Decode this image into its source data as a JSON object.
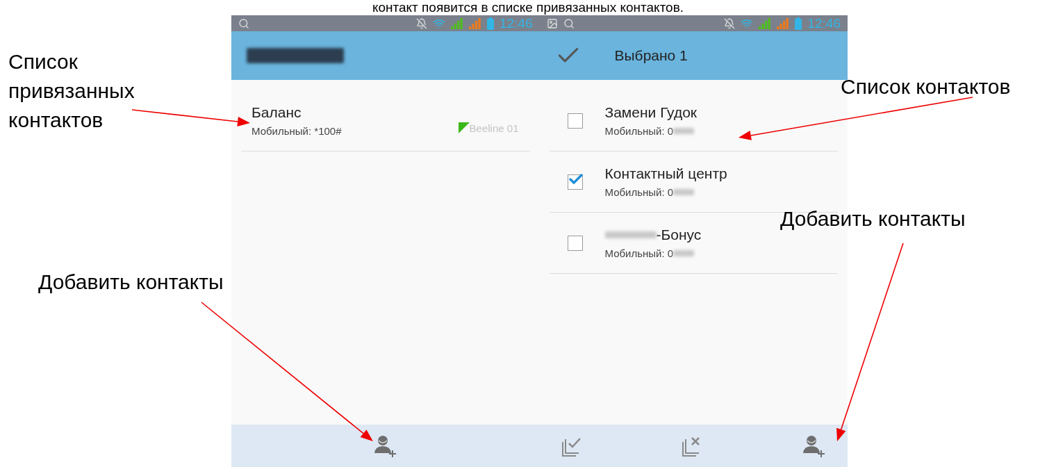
{
  "heading": "контакт появится в списке привязанных контактов.",
  "screens": [
    {
      "kind": "linked",
      "status_bar": {
        "time": "12:46"
      },
      "contacts": [
        {
          "name": "Баланс",
          "name_blurred": false,
          "phone": "Мобильный: *100#",
          "phone_blurred": false,
          "sim": "Beeline 01"
        }
      ],
      "bottom_actions": [
        {
          "kind": "add-contact"
        }
      ]
    },
    {
      "kind": "select",
      "status_bar": {
        "time": "12:46"
      },
      "app_bar": {
        "title": "Выбрано 1"
      },
      "contacts": [
        {
          "name": "Замени Гудок",
          "name_blurred": false,
          "phone": "Мобильный: 0",
          "phone_blurred": true,
          "checked": false
        },
        {
          "name": "Контактный центр",
          "name_blurred": false,
          "phone": "Мобильный: 0",
          "phone_blurred": true,
          "checked": true
        },
        {
          "name": "-Бонус",
          "name_blurred": true,
          "phone": "Мобильный: 0",
          "phone_blurred": true,
          "checked": false
        }
      ],
      "bottom_actions": [
        {
          "kind": "select-all"
        },
        {
          "kind": "deselect-all"
        },
        {
          "kind": "add-contact"
        }
      ]
    }
  ],
  "annotations": [
    {
      "text": "Список привязанных контактов"
    },
    {
      "text": "Добавить контакты"
    },
    {
      "text": "Список контактов"
    },
    {
      "text": "Добавить контакты"
    }
  ]
}
